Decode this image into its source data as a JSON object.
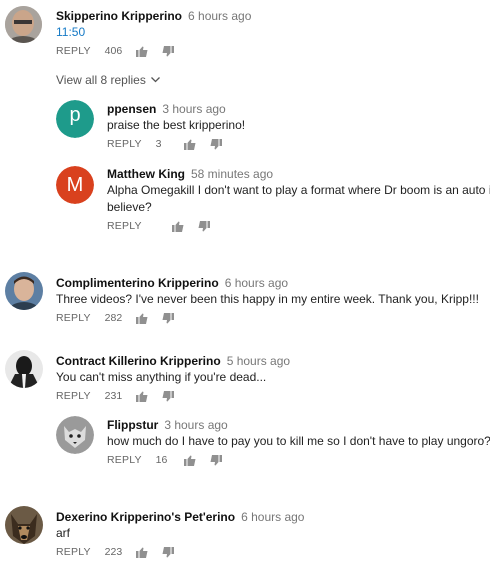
{
  "comments": [
    {
      "author": "Skipperino Kripperino",
      "time": "6 hours ago",
      "text": "11:50",
      "reply": "REPLY",
      "likes": "406"
    },
    {
      "author": "Complimenterino Kripperino",
      "time": "6 hours ago",
      "text": "Three videos? I've never been this happy in my entire week. Thank you, Kripp!!!",
      "reply": "REPLY",
      "likes": "282"
    },
    {
      "author": "Contract Killerino Kripperino",
      "time": "5 hours ago",
      "text": "You can't miss anything if you're dead...",
      "reply": "REPLY",
      "likes": "231"
    },
    {
      "author": "Dexerino Kripperino's Pet'erino",
      "time": "6 hours ago",
      "text": "arf",
      "reply": "REPLY",
      "likes": "223"
    }
  ],
  "view_replies": "View all 8 replies",
  "replies": [
    {
      "author": "ppensen",
      "time": "3 hours ago",
      "text": "praise the best kripperino!",
      "reply": "REPLY",
      "likes": "3",
      "avatar_letter": "p",
      "avatar_color": "#1e9b8b"
    },
    {
      "author": "Matthew King",
      "time": "58 minutes ago",
      "text_line1": "Alpha Omegakill I don't want to play a format where Dr boom is an auto includ",
      "text_line2": "believe?",
      "reply": "REPLY",
      "avatar_letter": "M",
      "avatar_color": "#d9411e"
    },
    {
      "author": "Flippstur",
      "time": "3 hours ago",
      "text": "how much do I have to pay you to kill me so I don't have to play ungoro?",
      "reply": "REPLY",
      "likes": "16"
    }
  ],
  "colors": {
    "link": "#167ac6",
    "meta": "#777777"
  }
}
